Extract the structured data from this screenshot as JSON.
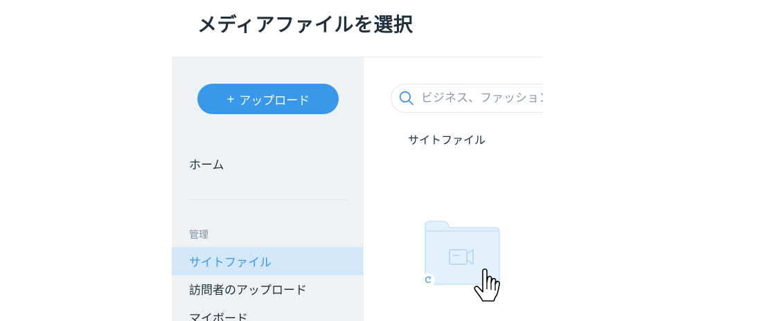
{
  "dialog": {
    "title": "メディアファイルを選択"
  },
  "sidebar": {
    "upload_button": {
      "plus": "+",
      "label": "アップロード"
    },
    "home": "ホーム",
    "section_label": "管理",
    "items": [
      {
        "label": "サイトファイル",
        "active": true
      },
      {
        "label": "訪問者のアップロード",
        "active": false
      },
      {
        "label": "マイボード",
        "active": false
      }
    ]
  },
  "main": {
    "search": {
      "placeholder": "ビジネス、ファッション",
      "value": ""
    },
    "breadcrumb": "サイトファイル",
    "empty_state_icon": "video-folder-icon"
  },
  "colors": {
    "accent": "#3899ec",
    "sidebar_bg": "#eff2f5",
    "active_bg": "#d3e7f9",
    "text": "#20303c"
  }
}
